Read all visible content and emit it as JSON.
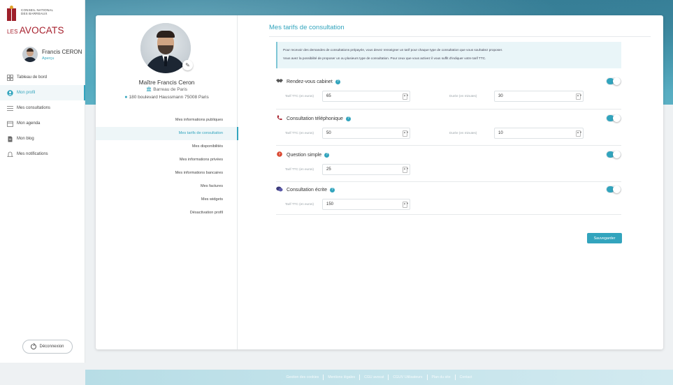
{
  "logo": {
    "small_line1": "Conseil national",
    "small_line2": "des barreaux",
    "les": "LES",
    "brand": "AVOCATS"
  },
  "user": {
    "name": "Francis CERON",
    "preview_label": "Aperçu"
  },
  "nav": {
    "items": [
      {
        "label": "Tableau de bord",
        "icon": "dashboard-icon"
      },
      {
        "label": "Mon profil",
        "icon": "user-circle-icon"
      },
      {
        "label": "Mes consultations",
        "icon": "list-icon"
      },
      {
        "label": "Mon agenda",
        "icon": "calendar-icon"
      },
      {
        "label": "Mon blog",
        "icon": "document-icon"
      },
      {
        "label": "Mes notifications",
        "icon": "bell-icon"
      }
    ],
    "active_index": 1,
    "logout_label": "Déconnexion"
  },
  "profile": {
    "name": "Maître Francis Ceron",
    "bar": "Barreau de Paris",
    "address": "180 boulevard Haussmann 75008 Paris"
  },
  "menu": {
    "items": [
      "Mes informations publiques",
      "Mes tarifs de consultation",
      "Mes disponibilités",
      "Mes informations privées",
      "Mes informations bancaires",
      "Mes factures",
      "Mes widgets",
      "Désactivation profil"
    ],
    "active_index": 1
  },
  "pricing": {
    "title": "Mes tarifs de consultation",
    "info_line1": "Pour recevoir des demandes de consultations prépayée, vous devez renseigner un tarif pour chaque type de consultation que vous souhaitez proposer.",
    "info_line2": "Vous avez la possibilité de proposer un ou plusieurs type de consultation. Pour ceux que vous activez il vous suffit d'indiquer votre tarif TTC.",
    "price_label": "Tarif TTC (en euros)",
    "duration_label": "Durée (en minutes)",
    "services": [
      {
        "name": "Rendez-vous cabinet",
        "icon": "handshake-icon",
        "price": "65",
        "duration": "30",
        "enabled": true
      },
      {
        "name": "Consultation téléphonique",
        "icon": "phone-icon",
        "price": "50",
        "duration": "10",
        "enabled": true
      },
      {
        "name": "Question simple",
        "icon": "question-icon",
        "price": "25",
        "enabled": true
      },
      {
        "name": "Consultation écrite",
        "icon": "chat-icon",
        "price": "150",
        "enabled": true
      }
    ],
    "save_label": "Sauvegarder"
  },
  "footer": {
    "links": [
      "Gestion des cookies",
      "Mentions légales",
      "CGU avocat",
      "CGUV Utilisateurs",
      "Plan du site",
      "Contact"
    ]
  },
  "colors": {
    "accent": "#32a4bd",
    "brand_red": "#a61e2b"
  }
}
